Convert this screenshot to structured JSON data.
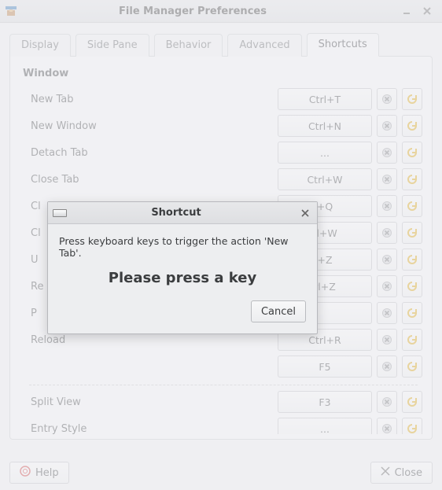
{
  "window": {
    "title": "File Manager Preferences"
  },
  "tabs": [
    {
      "label": "Display",
      "active": false
    },
    {
      "label": "Side Pane",
      "active": false
    },
    {
      "label": "Behavior",
      "active": false
    },
    {
      "label": "Advanced",
      "active": false
    },
    {
      "label": "Shortcuts",
      "active": true
    }
  ],
  "group": {
    "label": "Window"
  },
  "rows": [
    {
      "label": "New Tab",
      "shortcut": "Ctrl+T"
    },
    {
      "label": "New Window",
      "shortcut": "Ctrl+N"
    },
    {
      "label": "Detach Tab",
      "shortcut": "..."
    },
    {
      "label": "Close Tab",
      "shortcut": "Ctrl+W"
    },
    {
      "label": "Cl",
      "shortcut": "+Q"
    },
    {
      "label": "Cl",
      "shortcut": "rl+W"
    },
    {
      "label": "U",
      "shortcut": "+Z"
    },
    {
      "label": "Re",
      "shortcut": "rl+Z"
    },
    {
      "label": "P",
      "shortcut": ""
    },
    {
      "label": "Reload",
      "shortcut": "Ctrl+R"
    },
    {
      "label": "",
      "shortcut": "F5"
    },
    {
      "label": "Split View",
      "shortcut": "F3"
    },
    {
      "label": "Entry Style",
      "shortcut": "..."
    }
  ],
  "bottom": {
    "help": "Help",
    "close": "Close"
  },
  "dialog": {
    "title": "Shortcut",
    "message": "Press keyboard keys to trigger the action 'New Tab'.",
    "prompt": "Please press a key",
    "cancel": "Cancel"
  },
  "icons": {
    "app": "app-icon",
    "minimize": "minimize-icon",
    "close": "close-icon",
    "clear": "clear-icon",
    "revert": "revert-icon",
    "help": "help-icon",
    "closeX": "close-x-icon"
  }
}
